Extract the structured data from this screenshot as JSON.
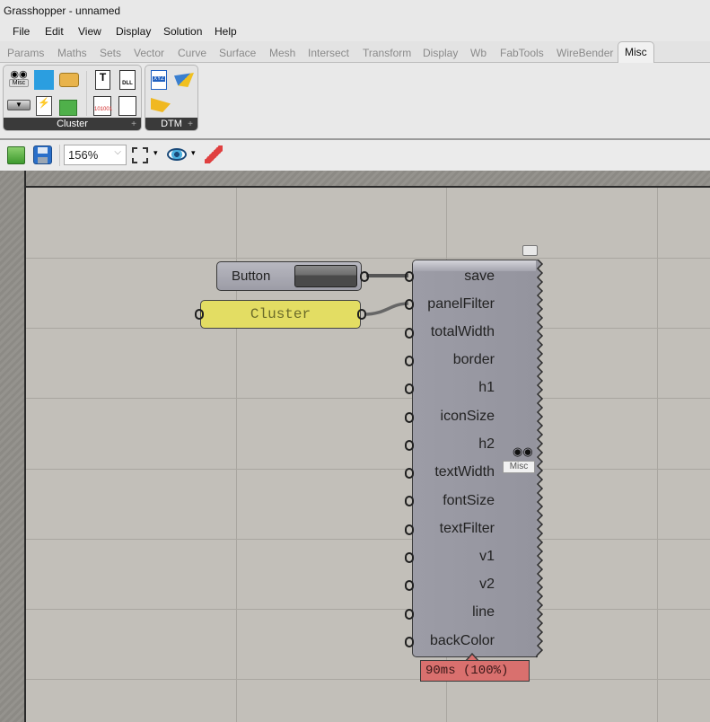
{
  "window": {
    "title": "Grasshopper - unnamed"
  },
  "menu": [
    "File",
    "Edit",
    "View",
    "Display",
    "Solution",
    "Help"
  ],
  "tabs": {
    "items": [
      "Params",
      "Maths",
      "Sets",
      "Vector",
      "Curve",
      "Surface",
      "Mesh",
      "Intersect",
      "Transform",
      "Display",
      "Wb",
      "FabTools",
      "WireBender",
      "Misc"
    ],
    "active": "Misc"
  },
  "ribbon": {
    "panels": [
      {
        "label": "Cluster",
        "icons": [
          "misc-cluster-icon",
          "binary-panel-icon",
          "speech-bubble-icon",
          "button-icon",
          "script-file-icon",
          "gift-box-icon",
          "text-file-icon",
          "dll-file-icon",
          "binary-file-icon",
          "binary-cluster-icon"
        ],
        "icon_texts": {
          "misc": "Misc",
          "dll": "DLL",
          "binary": "101001",
          "text": "T"
        }
      },
      {
        "label": "DTM",
        "icons": [
          "xyz-file-icon",
          "terrain-surface-icon",
          "terrain-wedge-icon"
        ],
        "icon_texts": {
          "xyz": "XYZ"
        }
      }
    ],
    "expand_symbol": "+"
  },
  "toolbar": {
    "zoom_value": "156%",
    "icons": [
      "open-folder-icon",
      "save-disk-icon",
      "zoom-extents-icon",
      "preview-eye-icon",
      "sketch-pen-icon"
    ]
  },
  "canvas": {
    "button_component": {
      "label": "Button"
    },
    "panel_component": {
      "text": "Cluster"
    },
    "cluster_component": {
      "inputs": [
        "save",
        "panelFilter",
        "totalWidth",
        "border",
        "h1",
        "iconSize",
        "h2",
        "textWidth",
        "fontSize",
        "textFilter",
        "v1",
        "v2",
        "line",
        "backColor"
      ],
      "badge": "Misc",
      "timing": "90ms (100%)"
    },
    "colors": {
      "background": "#c2bfb9",
      "panel_yellow": "#e3dd63",
      "component_gray": "#9c9ca6",
      "timing_red": "#d9706e"
    }
  }
}
